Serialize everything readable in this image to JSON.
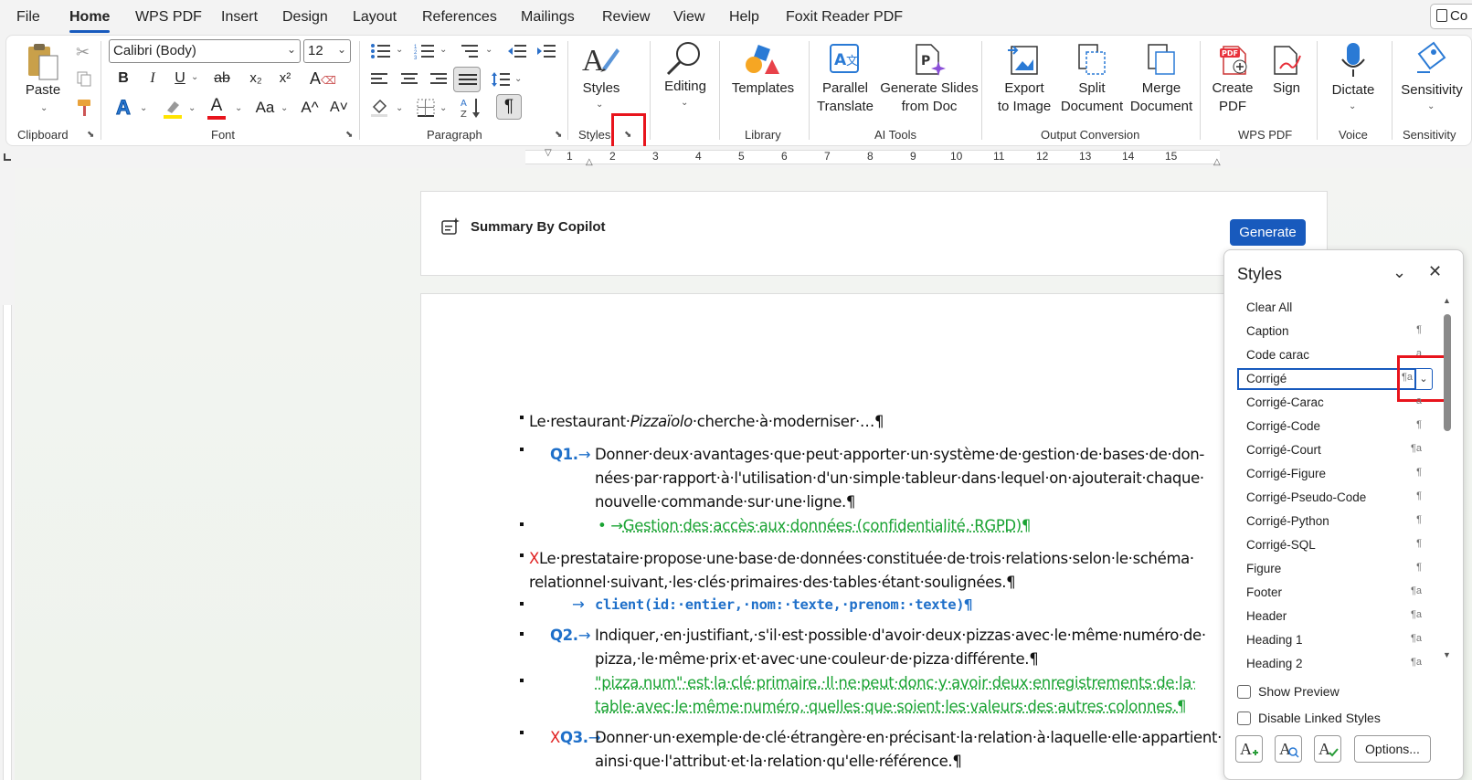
{
  "menu": {
    "tabs": [
      "File",
      "Home",
      "WPS PDF",
      "Insert",
      "Design",
      "Layout",
      "References",
      "Mailings",
      "Review",
      "View",
      "Help",
      "Foxit Reader PDF"
    ],
    "active": "Home",
    "copilot_label": "Co"
  },
  "ribbon": {
    "clipboard": {
      "paste": "Paste",
      "label": "Clipboard"
    },
    "font": {
      "name": "Calibri (Body)",
      "size": "12",
      "label": "Font",
      "bold": "B",
      "italic": "I",
      "underline": "U",
      "strike": "ab",
      "sub": "x₂",
      "sup": "x²",
      "clear": "A",
      "effects": "A",
      "change_case": "Aa",
      "grow": "A^",
      "shrink": "A˅",
      "color": "A"
    },
    "paragraph": {
      "label": "Paragraph",
      "pilcrow": "¶"
    },
    "styles": {
      "label_big": "Styles",
      "label": "Styles"
    },
    "editing": {
      "label": "Editing"
    },
    "library": {
      "templates": "Templates",
      "label": "Library"
    },
    "ai_tools": {
      "parallel_1": "Parallel",
      "parallel_2": "Translate",
      "gen_1": "Generate Slides",
      "gen_2": "from Doc",
      "label": "AI Tools"
    },
    "output": {
      "export_1": "Export",
      "export_2": "to Image",
      "split_1": "Split",
      "split_2": "Document",
      "merge_1": "Merge",
      "merge_2": "Document",
      "label": "Output Conversion"
    },
    "wps_pdf": {
      "create_1": "Create",
      "create_2": "PDF",
      "sign": "Sign",
      "label": "WPS PDF"
    },
    "voice": {
      "dictate": "Dictate",
      "label": "Voice"
    },
    "sensitivity": {
      "btn": "Sensitivity",
      "label": "Sensitivity"
    }
  },
  "ruler": {
    "numbers": [
      "1",
      "2",
      "3",
      "4",
      "5",
      "6",
      "7",
      "8",
      "9",
      "10",
      "11",
      "12",
      "13",
      "14",
      "15"
    ]
  },
  "copilot": {
    "title": "Summary By Copilot",
    "generate": "Generate"
  },
  "document": {
    "line1": {
      "a": "Le·restaurant·",
      "b": "Pizzaïolo",
      "c": "·cherche·à·moderniser·…¶"
    },
    "q1": {
      "num": "Q1.",
      "arrow": "→",
      "l1": "Donner·deux·avantages·que·peut·apporter·un·système·de·gestion·de·bases·de·don-",
      "l2": "nées·par·rapport·à·l'utilisation·d'un·simple·tableur·dans·lequel·on·ajouterait·chaque·",
      "l3": "nouvelle·commande·sur·une·ligne.¶"
    },
    "q1_answer": {
      "dot": "•",
      "arrow": "→",
      "text": "Gestion·des·accès·aux·données·(confidentialité,·RGPD)¶"
    },
    "para2": {
      "x": "X",
      "l1": "Le·prestataire·propose·une·base·de·données·constituée·de·trois·relations·selon·le·schéma·",
      "l2": "relationnel·suivant,·les·clés·primaires·des·tables·étant·soulignées.¶"
    },
    "schema": {
      "arrow": "→",
      "text": "client(id:·entier,·nom:·texte,·prenom:·texte)¶"
    },
    "q2": {
      "num": "Q2.",
      "arrow": "→",
      "l1": "Indiquer,·en·justifiant,·s'il·est·possible·d'avoir·deux·pizzas·avec·le·même·numéro·de·",
      "l2": "pizza,·le·même·prix·et·avec·une·couleur·de·pizza·différente.¶"
    },
    "q2_answer": {
      "l1": "\"pizza.num\"·est·la·clé·primaire.·Il·ne·peut·donc·y·avoir·deux·enregistrements·de·la·",
      "l2": "table·avec·le·même·numéro,·quelles·que·soient·les·valeurs·des·autres·colonnes.¶"
    },
    "q3": {
      "x": "X",
      "num": "Q3.",
      "arrow": "→",
      "l1": "Donner·un·exemple·de·clé·étrangère·en·précisant·la·relation·à·laquelle·elle·appartient·",
      "l2": "ainsi·que·l'attribut·et·la·relation·qu'elle·référence.¶"
    }
  },
  "styles_pane": {
    "title": "Styles",
    "items": [
      {
        "name": "Clear All",
        "ind": ""
      },
      {
        "name": "Caption",
        "ind": "¶"
      },
      {
        "name": "Code carac",
        "ind": "a"
      },
      {
        "name": "Corrigé",
        "ind": "¶a"
      },
      {
        "name": "Corrigé-Carac",
        "ind": "a"
      },
      {
        "name": "Corrigé-Code",
        "ind": "¶"
      },
      {
        "name": "Corrigé-Court",
        "ind": "¶a"
      },
      {
        "name": "Corrigé-Figure",
        "ind": "¶"
      },
      {
        "name": "Corrigé-Pseudo-Code",
        "ind": "¶"
      },
      {
        "name": "Corrigé-Python",
        "ind": "¶"
      },
      {
        "name": "Corrigé-SQL",
        "ind": "¶"
      },
      {
        "name": "Figure",
        "ind": "¶"
      },
      {
        "name": "Footer",
        "ind": "¶a"
      },
      {
        "name": "Header",
        "ind": "¶a"
      },
      {
        "name": "Heading 1",
        "ind": "¶a"
      },
      {
        "name": "Heading 2",
        "ind": "¶a"
      }
    ],
    "selected": "Corrigé",
    "show_preview": "Show Preview",
    "disable_linked": "Disable Linked Styles",
    "options": "Options..."
  }
}
